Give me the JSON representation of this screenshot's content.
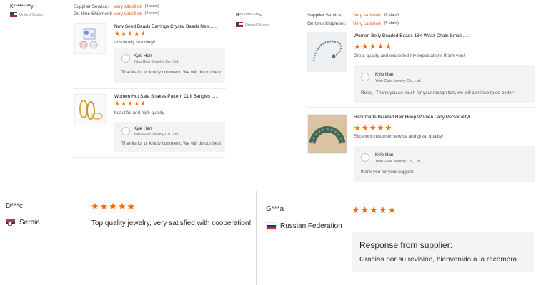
{
  "review1": {
    "buyer": "K*********y",
    "country": "United States",
    "supplier_service_label": "Supplier Service:",
    "supplier_service_value": "Very satisfied",
    "supplier_service_stars": "(5 stars)",
    "ontime_label": "On-time Shipment:",
    "ontime_value": "Very satisfied",
    "ontime_stars": "(5 stars)",
    "products": [
      {
        "title": "New Seed Beads Earrings Crystal Beads New......",
        "stars": "★★★★★",
        "comment": "absolutely stunning!!",
        "reply": {
          "name": "Kyle Han",
          "company": "Yiwu Gute Jewelry Co., Ltd.",
          "text": "Thanks for ur kindly comment. We will do our best"
        }
      },
      {
        "title": "Women Hot Sale Snakes Pattern Cuff Bangles .....",
        "stars": "★★★★★",
        "comment": "beautiful and high quality",
        "reply": {
          "name": "Kyle Han",
          "company": "Yiwu Gute Jewelry Co., Ltd.",
          "text": "Thanks for ur kindly comment. We will do our best"
        }
      }
    ]
  },
  "review2": {
    "buyer": "R**********s",
    "country": "United States",
    "supplier_service_label": "Supplier Service:",
    "supplier_service_value": "Very satisfied",
    "supplier_service_stars": "(5 stars)",
    "ontime_label": "On-time Shipment:",
    "ontime_value": "Very satisfied",
    "ontime_stars": "(5 stars)",
    "products": [
      {
        "title": "Women Belly Beaded Beads 18K Waist Chain Small .....",
        "stars": "★★★★★",
        "comment": "Great quality and exceeded my expectations thank you!",
        "reply": {
          "name": "Kyle Han",
          "company": "Yiwu Gute Jewelry Co., Ltd.",
          "text": "Rose、Thank you so much for your recognition, we will continue to do better~"
        }
      },
      {
        "title": "Handmade Braided Hair Hoop Women Lady Personalityl .....",
        "stars": "★★★★★",
        "comment": "Excellent customer service and great quality!",
        "reply": {
          "name": "Kyle Han",
          "company": "Yiwu Gute Jewelry Co., Ltd.",
          "text": "thank you for your support"
        }
      }
    ]
  },
  "review3": {
    "buyer": "D***c",
    "country": "Serbia",
    "stars": "★★★★★",
    "comment": "Top quality jewelry, very satisfied with cooperation!"
  },
  "review4": {
    "buyer": "G***a",
    "country": "Russian Federation",
    "stars": "★★★★★",
    "response_title": "Response from supplier:",
    "response_text": "Gracias por su revisión, bienvenido a la recompra"
  },
  "colors": {
    "accent": "#ff6a00",
    "satisfied": "#e85c0d",
    "reply_bg": "#f3f3f3"
  },
  "icons": {
    "us_flag": "us-flag-icon",
    "serbia_flag": "serbia-flag-icon",
    "russia_flag": "russia-flag-icon",
    "seller_logo": "seller-logo-icon"
  }
}
